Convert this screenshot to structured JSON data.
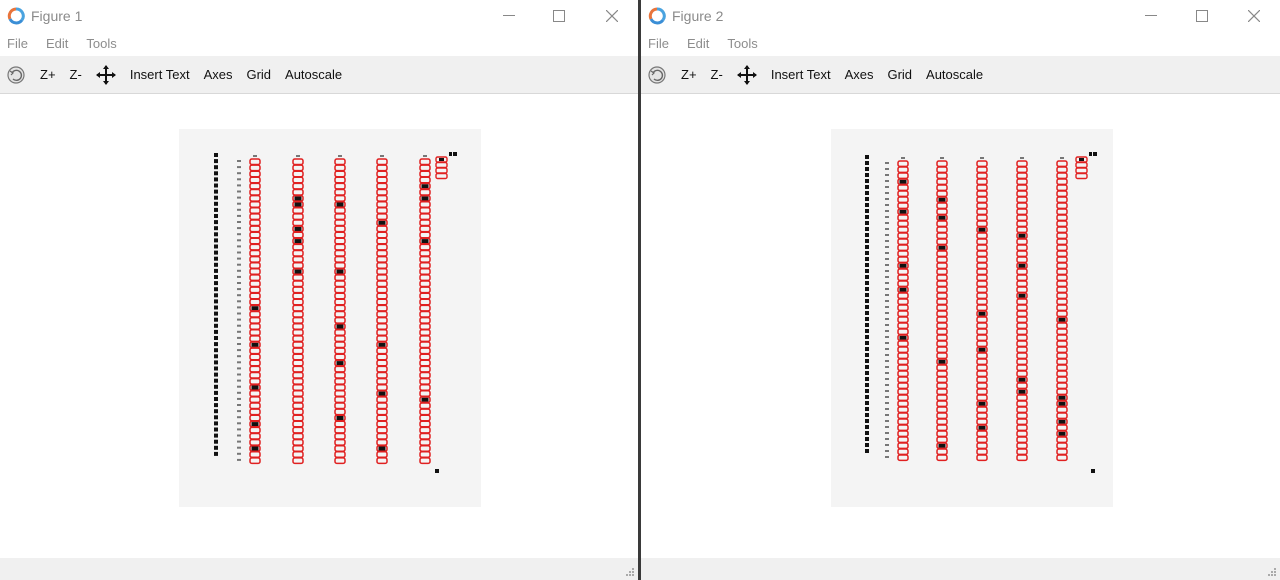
{
  "windows": [
    {
      "title": "Figure 1",
      "menu": [
        "File",
        "Edit",
        "Tools"
      ],
      "toolbar": {
        "zoom_in": "Z+",
        "zoom_out": "Z-",
        "insert_text": "Insert Text",
        "axes": "Axes",
        "grid": "Grid",
        "autoscale": "Autoscale"
      },
      "icons": {
        "app": "figure-app-icon",
        "rotate": "rotate-icon",
        "pan": "pan-arrows-icon"
      }
    },
    {
      "title": "Figure 2",
      "menu": [
        "File",
        "Edit",
        "Tools"
      ],
      "toolbar": {
        "zoom_in": "Z+",
        "zoom_out": "Z-",
        "insert_text": "Insert Text",
        "axes": "Axes",
        "grid": "Grid",
        "autoscale": "Autoscale"
      },
      "icons": {
        "app": "figure-app-icon",
        "rotate": "rotate-icon",
        "pan": "pan-arrows-icon"
      }
    }
  ],
  "colors": {
    "bubble_outline": "#e02020",
    "mark": "#111111",
    "sheet": "#f4f4f4"
  },
  "figures": [
    {
      "question_count": 50,
      "answer_columns": 5,
      "filled": [
        [
          43,
          30,
          47,
          24,
          37
        ],
        [
          6,
          18,
          7,
          13,
          11
        ],
        [
          7,
          42,
          18,
          33,
          27
        ],
        [
          38,
          38,
          10,
          30,
          47
        ],
        [
          4,
          13,
          6,
          39,
          4
        ]
      ]
    },
    {
      "question_count": 50,
      "answer_columns": 5,
      "filled": [
        [
          8,
          21,
          29,
          17,
          3
        ],
        [
          14,
          6,
          9,
          47,
          33
        ],
        [
          25,
          31,
          40,
          11,
          44
        ],
        [
          36,
          17,
          22,
          38,
          12
        ],
        [
          43,
          40,
          45,
          26,
          39
        ]
      ]
    }
  ]
}
